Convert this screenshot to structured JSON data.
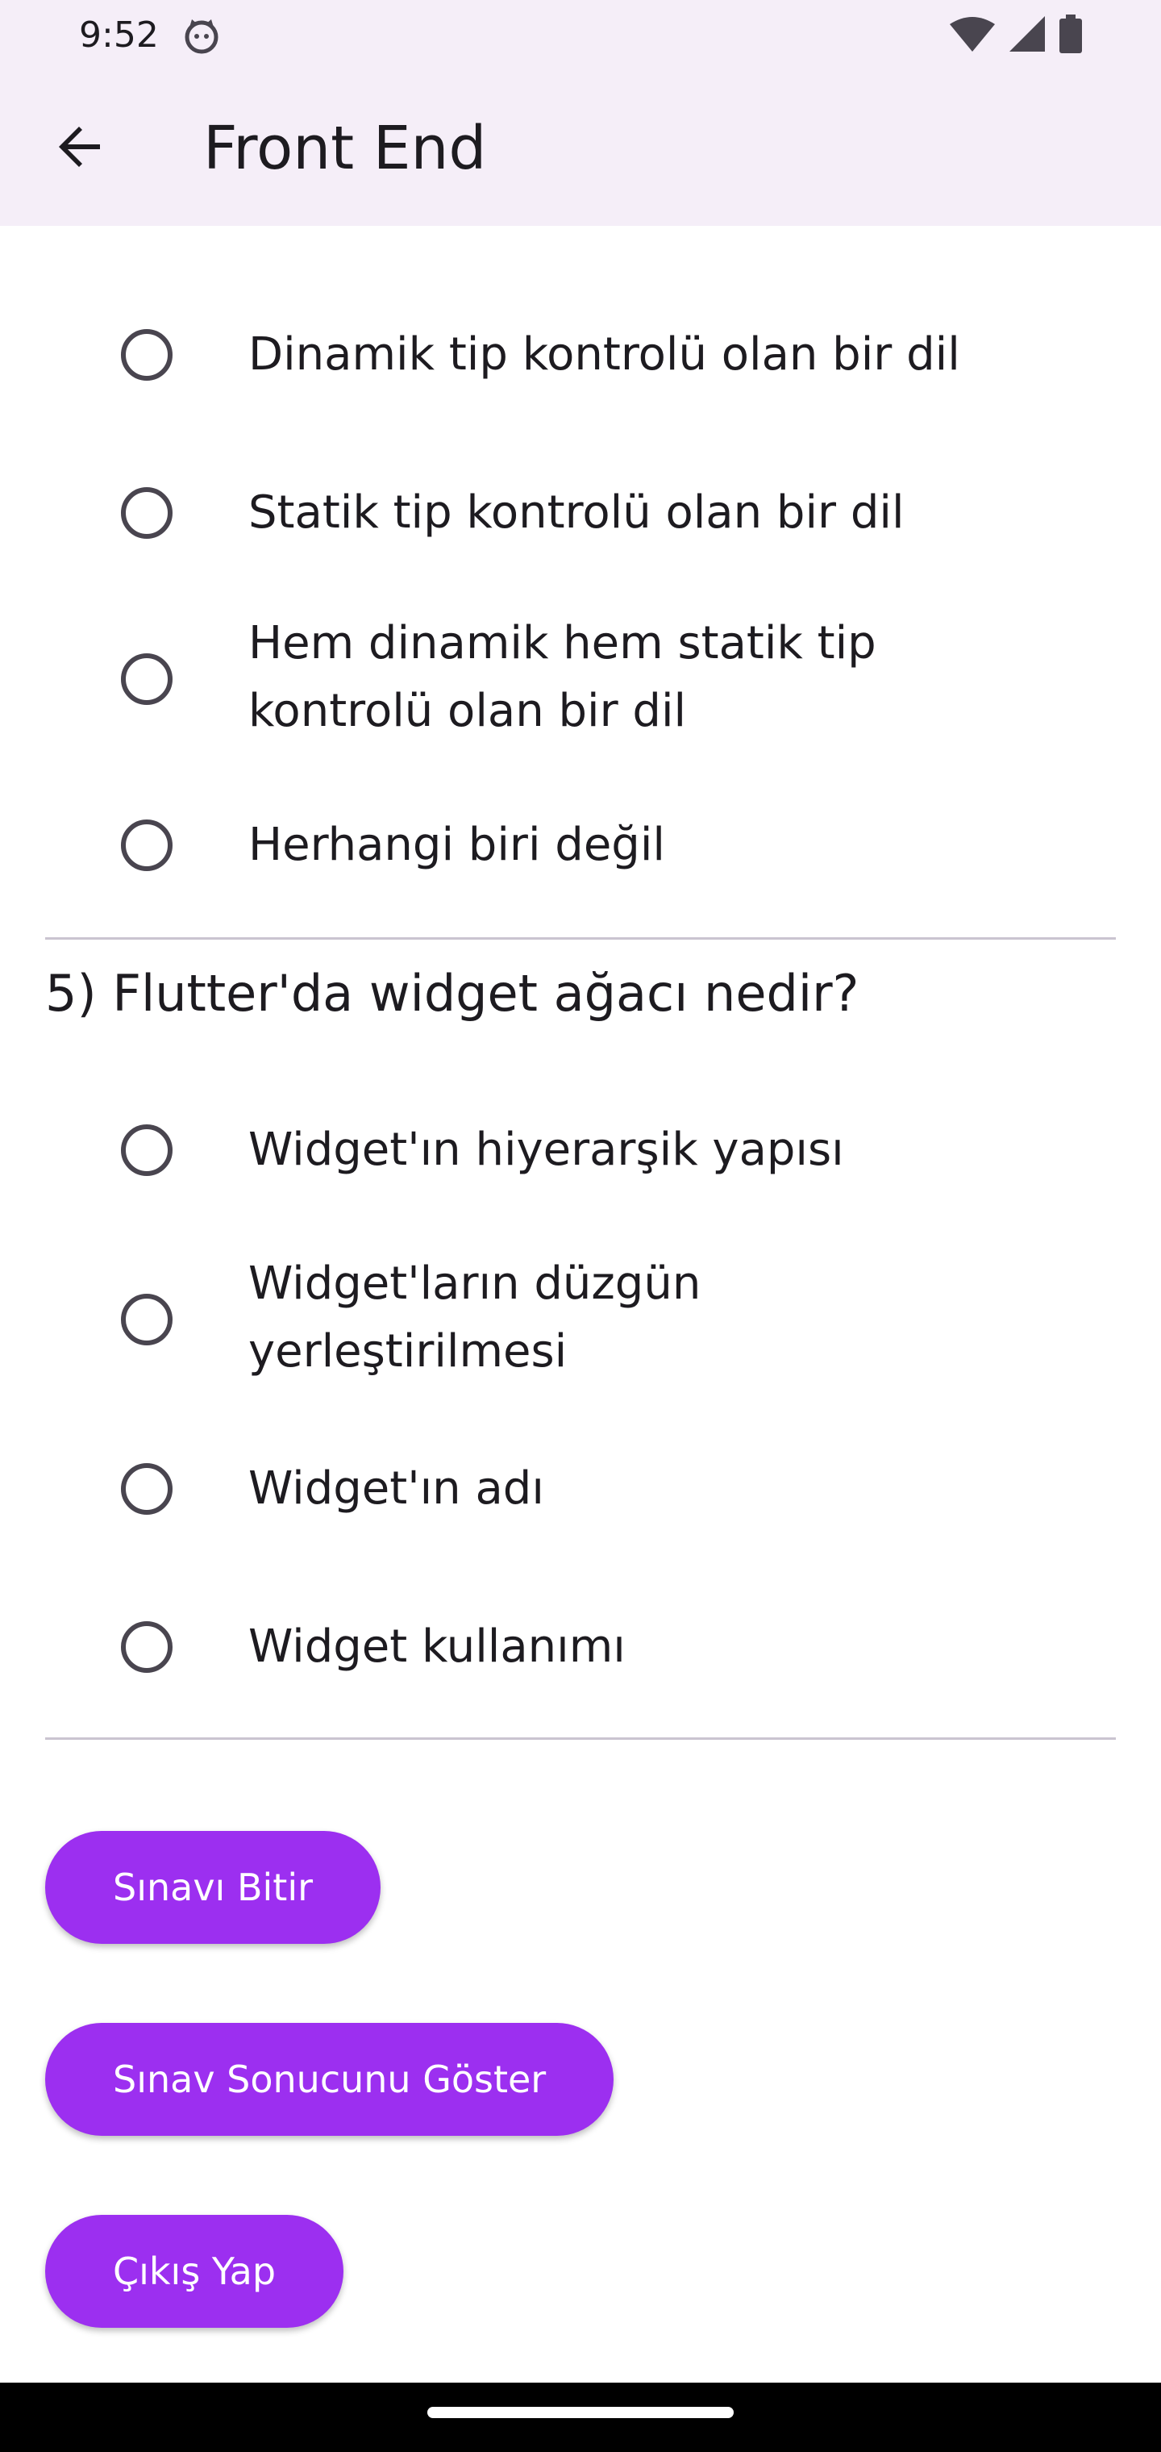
{
  "status_bar": {
    "time": "9:52"
  },
  "app_bar": {
    "title": "Front End"
  },
  "previous_question": {
    "options": [
      "Dinamik tip kontrolü olan bir dil",
      "Statik tip kontrolü olan bir dil",
      "Hem dinamik hem statik tip kontrolü olan bir dil",
      "Herhangi biri değil"
    ]
  },
  "question5": {
    "title": "5) Flutter'da widget ağacı nedir?",
    "options": [
      "Widget'ın hiyerarşik yapısı",
      "Widget'ların düzgün yerleştirilmesi",
      "Widget'ın adı",
      "Widget kullanımı"
    ]
  },
  "buttons": {
    "finish": "Sınavı Bitir",
    "show_result": "Sınav Sonucunu Göster",
    "exit": "Çıkış Yap"
  },
  "colors": {
    "primary": "#9c2ff0",
    "app_bar_bg": "#f5eef8",
    "radio_outline": "#49454f",
    "divider": "#cac4d0"
  },
  "icons": {
    "back": "arrow-left-icon",
    "wifi": "wifi-icon",
    "signal": "cellular-signal-icon",
    "battery": "battery-icon",
    "app_notification": "cat-face-icon",
    "radio": "radio-unselected-icon"
  }
}
